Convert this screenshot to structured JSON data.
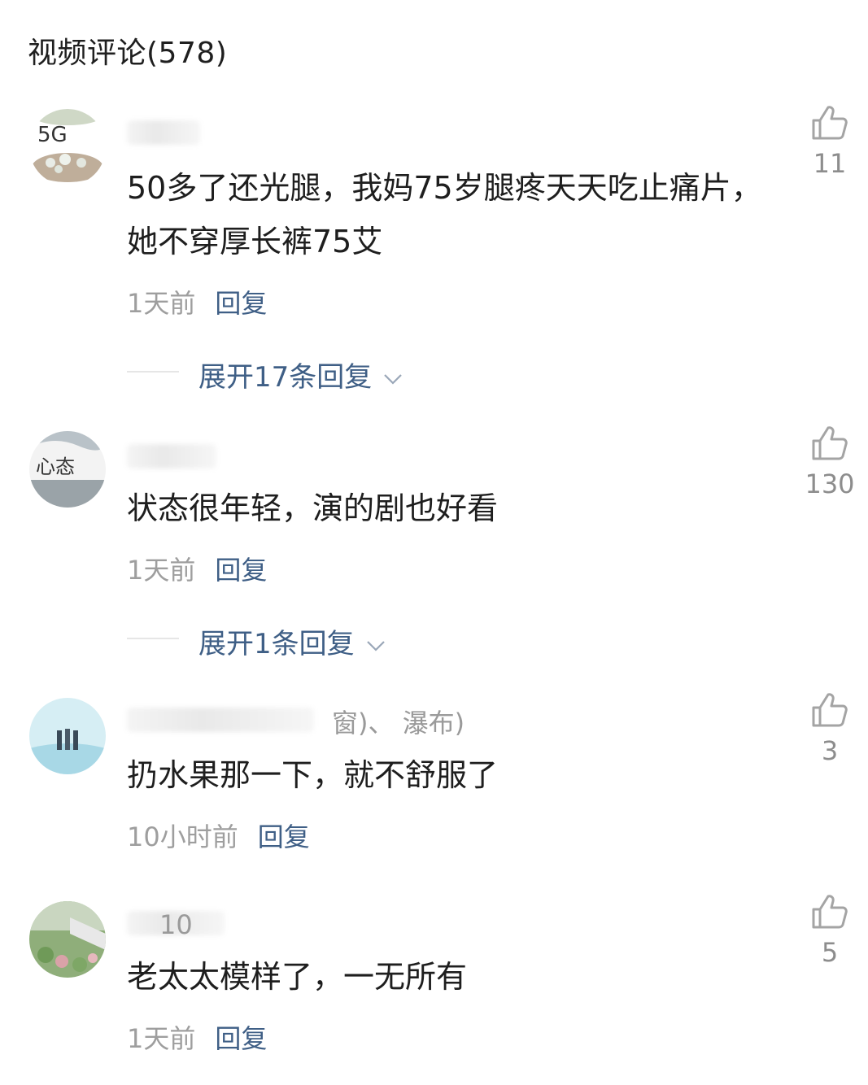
{
  "header": {
    "title": "视频评论(578)"
  },
  "comments": [
    {
      "username_tag": "",
      "text": "50多了还光腿，我妈75岁腿疼天天吃止痛片，她不穿厚长裤75艾",
      "time": "1天前",
      "reply_label": "回复",
      "likes": "11",
      "expand_label": "展开17条回复"
    },
    {
      "username_tag": "",
      "text": "状态很年轻，演的剧也好看",
      "time": "1天前",
      "reply_label": "回复",
      "likes": "130",
      "expand_label": "展开1条回复"
    },
    {
      "username_tag": "窗)、 瀑布)",
      "text": "扔水果那一下，就不舒服了",
      "time": "10小时前",
      "reply_label": "回复",
      "likes": "3",
      "expand_label": ""
    },
    {
      "username_tag": "10",
      "text": "老太太模样了，一无所有",
      "time": "1天前",
      "reply_label": "回复",
      "likes": "5",
      "expand_label": ""
    }
  ],
  "icons": {
    "like": "thumbs-up-icon",
    "expand": "chevron-down-icon"
  },
  "colors": {
    "link": "#3f5f86",
    "muted": "#9e9e9e",
    "text": "#1e1e1e"
  }
}
